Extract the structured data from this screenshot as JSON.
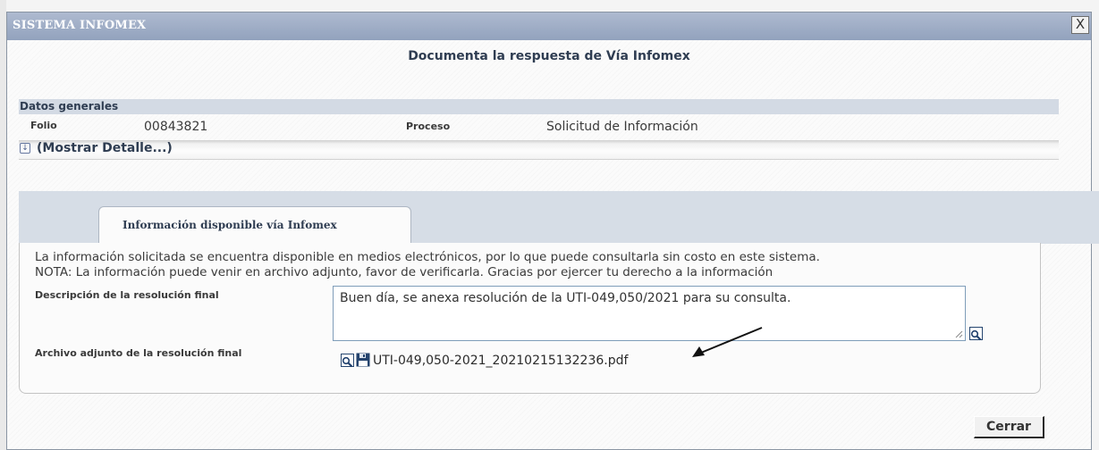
{
  "window": {
    "title": "SISTEMA INFOMEX",
    "close_label": "X"
  },
  "heading": "Documenta la respuesta de Vía Infomex",
  "general": {
    "section_title": "Datos generales",
    "folio_label": "Folio",
    "folio_value": "00843821",
    "proceso_label": "Proceso",
    "proceso_value": "Solicitud de Información",
    "toggle_icon": "double-chevron-down-icon",
    "toggle_label": "(Mostrar Detalle...)"
  },
  "tabs": [
    {
      "label": "Información disponible vía Infomex",
      "active": true
    }
  ],
  "panel": {
    "info_line1": "La información solicitada se encuentra disponible en medios electrónicos, por lo que puede consultarla sin costo en este sistema.",
    "info_line2": "NOTA: La información puede venir en archivo adjunto, favor de verificarla. Gracias por ejercer tu derecho a la información",
    "description_label": "Descripción de la resolución final",
    "description_value": "Buen día, se anexa resolución de la UTI-049,050/2021 para su consulta.",
    "attachment_label": "Archivo adjunto de la resolución final",
    "attachment_filename": "UTI-049,050-2021_20210215132236.pdf",
    "icons": [
      "magnifier-icon",
      "save-disk-icon"
    ]
  },
  "footer": {
    "close_button": "Cerrar"
  },
  "colors": {
    "titlebar": "#9dabc6",
    "section_band": "#d3dae4",
    "tabs_band": "#d6dde6",
    "heading_text": "#2f3d52"
  }
}
